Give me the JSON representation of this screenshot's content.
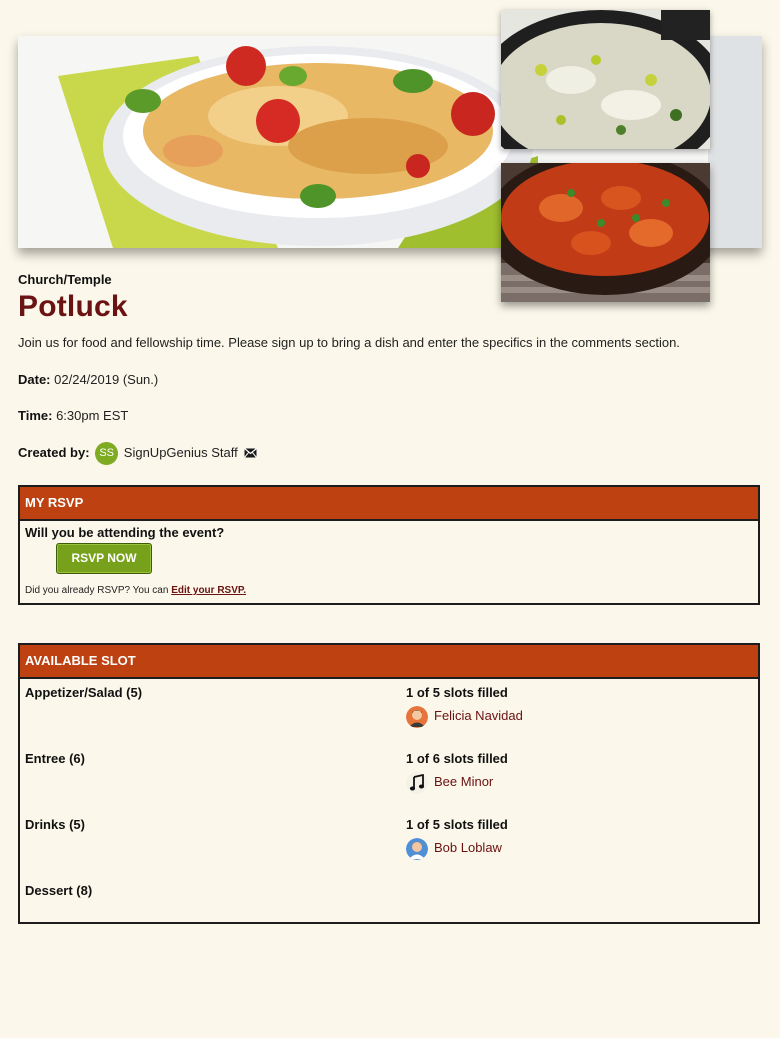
{
  "event": {
    "category": "Church/Temple",
    "title": "Potluck",
    "description": "Join us for food and fellowship time. Please sign up to bring a dish and enter the specifics in the comments section.",
    "date_label": "Date:",
    "date_value": "02/24/2019 (Sun.)",
    "time_label": "Time:",
    "time_value": "6:30pm EST",
    "created_label": "Created by:",
    "creator_initials": "SS",
    "creator_name": "SignUpGenius Staff"
  },
  "rsvp": {
    "header": "MY RSVP",
    "question": "Will you be attending the event?",
    "button_label": "RSVP NOW",
    "note_prefix": "Did you already RSVP? You can",
    "note_link": "Edit your RSVP."
  },
  "slots": {
    "header": "AVAILABLE SLOT",
    "rows": [
      {
        "name": "Appetizer/Salad (5)",
        "filled": "1 of 5 slots filled",
        "person": "Felicia Navidad",
        "avatar": "person-avatar-icon"
      },
      {
        "name": "Entree (6)",
        "filled": "1 of 6 slots filled",
        "person": "Bee Minor",
        "avatar": "music-note-icon"
      },
      {
        "name": "Drinks (5)",
        "filled": "1 of 5 slots filled",
        "person": "Bob Loblaw",
        "avatar": "person-avatar-icon"
      },
      {
        "name": "Dessert (8)"
      }
    ]
  },
  "colors": {
    "background": "#fbf7ea",
    "accent_header": "#bd4111",
    "title": "#6b1212",
    "button": "#77a11b",
    "avatar": "#7fab22"
  }
}
